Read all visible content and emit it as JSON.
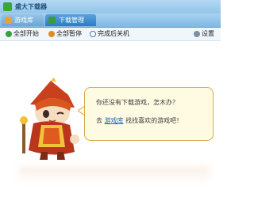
{
  "window": {
    "title": "盛大下载器"
  },
  "tabs": [
    {
      "label": "游戏库"
    },
    {
      "label": "下载管理"
    }
  ],
  "toolbar": {
    "start_all": "全部开始",
    "pause_all": "全部暂停",
    "shutdown_after": "完成后关机",
    "settings": "设置"
  },
  "empty_state": {
    "line1": "你还没有下载游戏，怎木办？",
    "prefix": "去",
    "link": "游戏库",
    "suffix": "找找喜欢的游戏吧！"
  },
  "colors": {
    "tab_active": "#2c7bc3",
    "link": "#1a63b8",
    "bubble_bg": "#fffbe3",
    "bubble_border": "#d7a849"
  }
}
